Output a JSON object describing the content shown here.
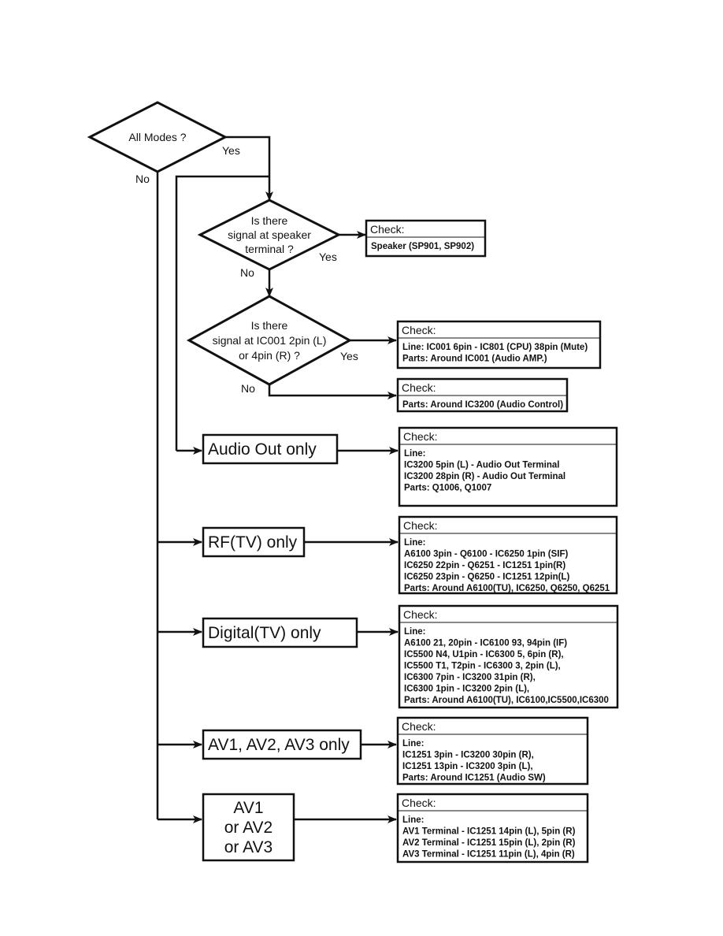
{
  "decisions": [
    {
      "lines": [
        "All Modes ?"
      ],
      "yes": "Yes",
      "no": "No"
    },
    {
      "lines": [
        "Is there",
        "signal at speaker",
        "terminal ?"
      ],
      "yes": "Yes",
      "no": "No"
    },
    {
      "lines": [
        "Is there",
        "signal at IC001 2pin (L)",
        "or 4pin (R) ?"
      ],
      "yes": "Yes",
      "no": "No"
    }
  ],
  "modes": [
    {
      "lines": [
        "Audio Out only"
      ]
    },
    {
      "lines": [
        "RF(TV) only"
      ]
    },
    {
      "lines": [
        "Digital(TV) only"
      ]
    },
    {
      "lines": [
        "AV1, AV2, AV3 only"
      ]
    },
    {
      "lines": [
        "AV1",
        "or AV2",
        "or AV3"
      ]
    }
  ],
  "checks": [
    {
      "title": "Check:",
      "lines": [
        "Speaker (SP901, SP902)"
      ]
    },
    {
      "title": "Check:",
      "lines": [
        "Line:  IC001 6pin - IC801 (CPU) 38pin (Mute)",
        "Parts: Around IC001 (Audio AMP.)"
      ]
    },
    {
      "title": "Check:",
      "lines": [
        "Parts: Around IC3200 (Audio Control)"
      ]
    },
    {
      "title": "Check:",
      "lines": [
        "Line:",
        "IC3200 5pin (L) - Audio Out Terminal",
        "IC3200 28pin (R) - Audio Out Terminal",
        "Parts: Q1006, Q1007"
      ]
    },
    {
      "title": "Check:",
      "lines": [
        "Line:",
        "A6100 3pin - Q6100 - IC6250 1pin (SIF)",
        "IC6250 22pin - Q6251 -  IC1251 1pin(R)",
        "IC6250 23pin - Q6250 -  IC1251 12pin(L)",
        "Parts: Around A6100(TU), IC6250, Q6250, Q6251"
      ]
    },
    {
      "title": "Check:",
      "lines": [
        "Line:",
        "A6100 21, 20pin - IC6100 93, 94pin (IF)",
        "IC5500 N4, U1pin - IC6300 5, 6pin (R),",
        "IC5500 T1, T2pin - IC6300 3, 2pin (L),",
        "IC6300 7pin - IC3200 31pin (R),",
        "IC6300 1pin - IC3200 2pin (L),",
        "Parts: Around A6100(TU), IC6100,IC5500,IC6300"
      ]
    },
    {
      "title": "Check:",
      "lines": [
        "Line:",
        "IC1251 3pin - IC3200 30pin (R),",
        "IC1251 13pin - IC3200 3pin (L),",
        "Parts:  Around IC1251 (Audio SW)"
      ]
    },
    {
      "title": "Check:",
      "lines": [
        "Line:",
        "AV1 Terminal - IC1251 14pin (L), 5pin (R)",
        "AV2 Terminal - IC1251 15pin (L), 2pin (R)",
        "AV3 Terminal - IC1251 11pin (L), 4pin (R)"
      ]
    }
  ]
}
